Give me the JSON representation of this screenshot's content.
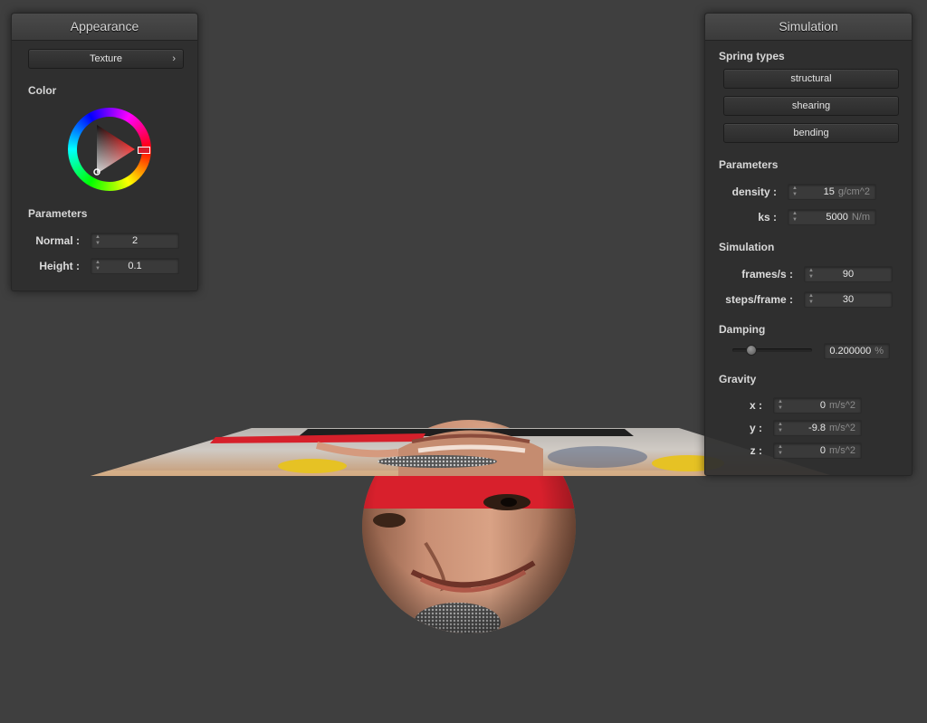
{
  "appearance": {
    "title": "Appearance",
    "texture_button": "Texture",
    "texture_arrow": "›",
    "color_label": "Color",
    "params_label": "Parameters",
    "normal": {
      "label": "Normal :",
      "value": "2"
    },
    "height": {
      "label": "Height :",
      "value": "0.1"
    },
    "selected_hue_color": "#ff0000"
  },
  "simulation": {
    "title": "Simulation",
    "spring_types_label": "Spring types",
    "spring_buttons": [
      "structural",
      "shearing",
      "bending"
    ],
    "params_label": "Parameters",
    "density": {
      "label": "density :",
      "value": "15",
      "unit": "g/cm^2"
    },
    "ks": {
      "label": "ks :",
      "value": "5000",
      "unit": "N/m"
    },
    "sim_label": "Simulation",
    "fps": {
      "label": "frames/s :",
      "value": "90"
    },
    "steps": {
      "label": "steps/frame :",
      "value": "30"
    },
    "damping_label": "Damping",
    "damping": {
      "value": "0.200000",
      "unit": "%",
      "fraction": 0.2
    },
    "gravity_label": "Gravity",
    "gx": {
      "label": "x :",
      "value": "0",
      "unit": "m/s^2"
    },
    "gy": {
      "label": "y :",
      "value": "-9.8",
      "unit": "m/s^2"
    },
    "gz": {
      "label": "z :",
      "value": "0",
      "unit": "m/s^2"
    }
  },
  "colors": {
    "background": "#3f3f3f",
    "panel": "#2f2f2f",
    "cap_red": "#e01a28"
  }
}
